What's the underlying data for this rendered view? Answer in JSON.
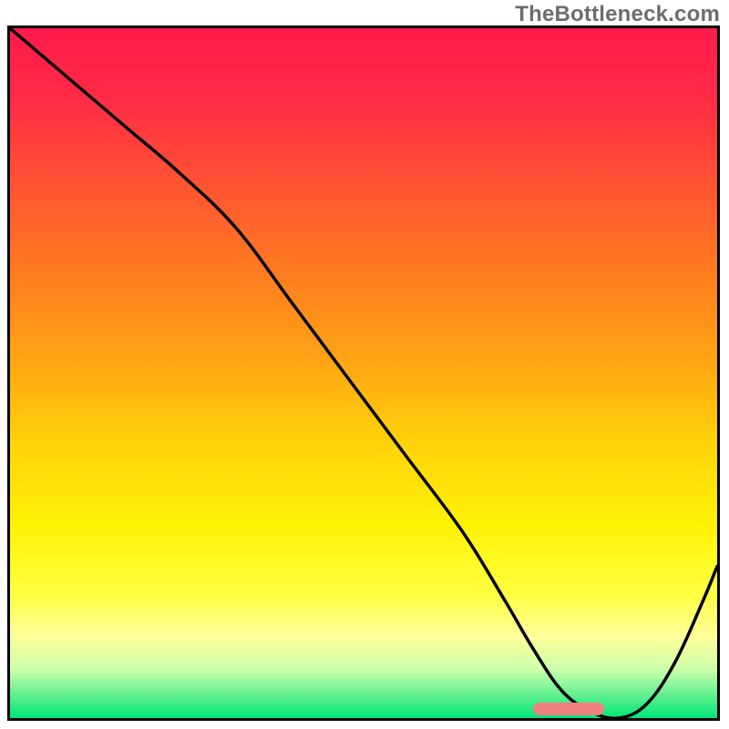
{
  "watermark": "TheBottleneck.com",
  "colors": {
    "frame": "#000000",
    "curve": "#000000",
    "marker": "#f08080",
    "gradient_stops": [
      {
        "offset": 0.0,
        "color": "#ff1a4b"
      },
      {
        "offset": 0.1,
        "color": "#ff2b46"
      },
      {
        "offset": 0.22,
        "color": "#ff5133"
      },
      {
        "offset": 0.35,
        "color": "#ff7a20"
      },
      {
        "offset": 0.48,
        "color": "#ffa414"
      },
      {
        "offset": 0.6,
        "color": "#ffd20a"
      },
      {
        "offset": 0.72,
        "color": "#fff205"
      },
      {
        "offset": 0.82,
        "color": "#ffff40"
      },
      {
        "offset": 0.88,
        "color": "#ffff99"
      },
      {
        "offset": 0.93,
        "color": "#ccffaa"
      },
      {
        "offset": 0.965,
        "color": "#66f090"
      },
      {
        "offset": 1.0,
        "color": "#00e676"
      }
    ]
  },
  "chart_data": {
    "type": "line",
    "title": "",
    "xlabel": "",
    "ylabel": "",
    "xlim": [
      0,
      100
    ],
    "ylim": [
      0,
      100
    ],
    "grid": false,
    "series": [
      {
        "name": "bottleneck-curve",
        "x": [
          0,
          8,
          16,
          24,
          32,
          40,
          48,
          56,
          64,
          70,
          74,
          78,
          82,
          86,
          90,
          94,
          98,
          100
        ],
        "y": [
          100,
          93,
          86,
          79,
          71,
          60,
          49,
          38,
          27,
          17,
          10,
          4,
          1,
          0,
          2,
          8,
          17,
          22
        ]
      }
    ],
    "annotations": [
      {
        "name": "optimal-range-marker",
        "type": "rect",
        "x_start": 74,
        "x_end": 84,
        "y": 0.5,
        "height": 2
      }
    ],
    "legend": false
  }
}
